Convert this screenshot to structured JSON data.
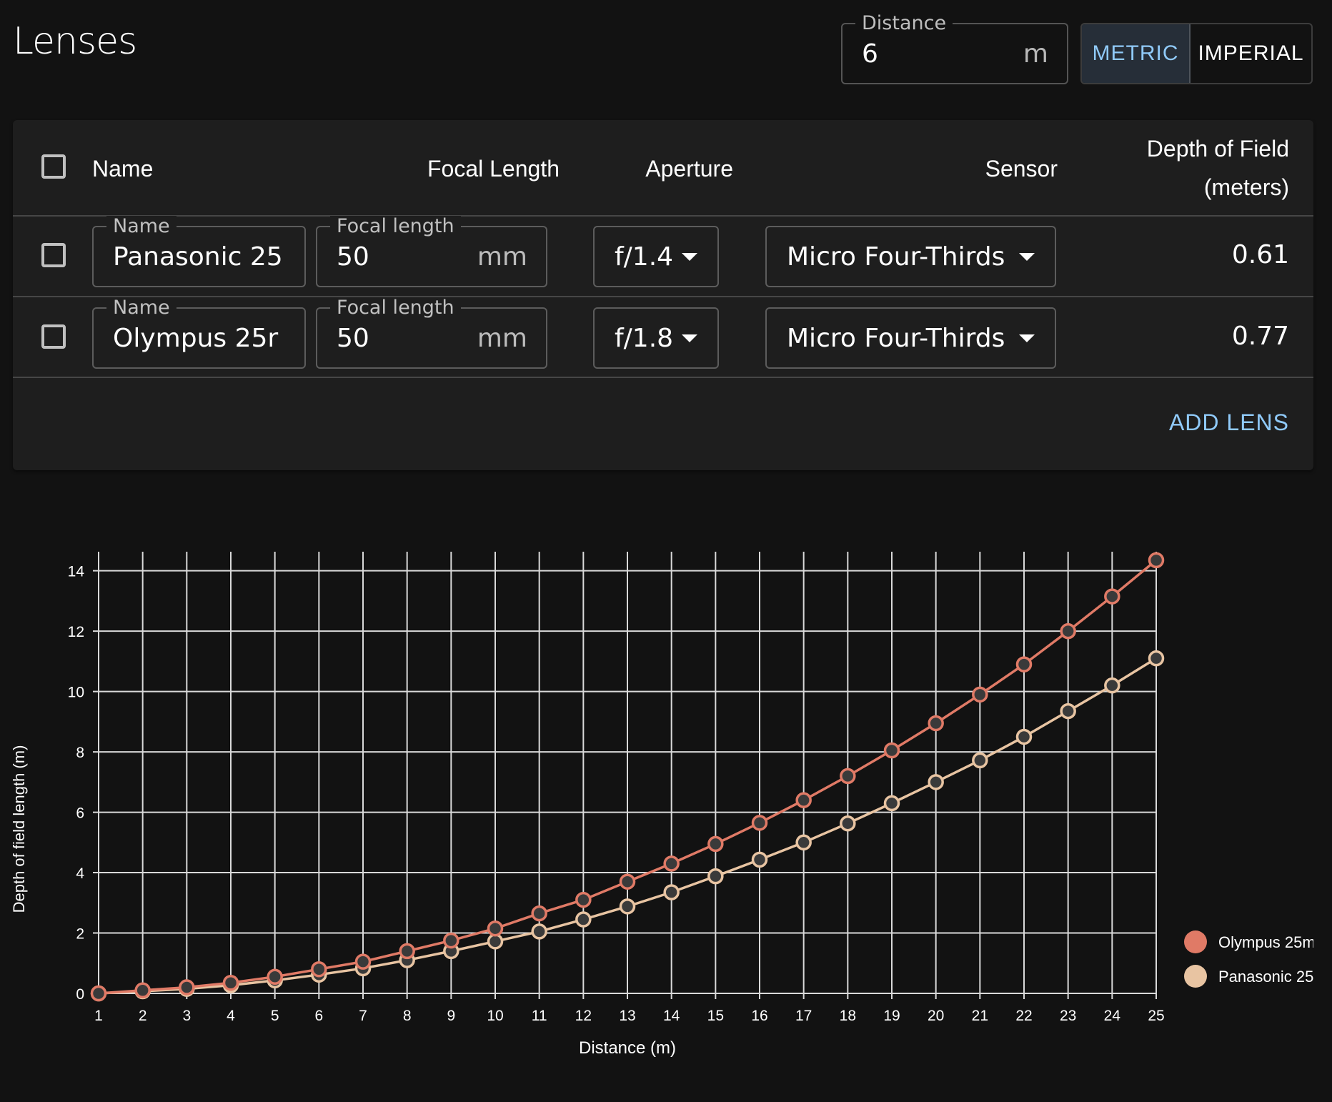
{
  "page": {
    "title": "Lenses"
  },
  "distance": {
    "label": "Distance",
    "value": "6",
    "unit": "m"
  },
  "units_toggle": {
    "metric_label": "METRIC",
    "imperial_label": "IMPERIAL",
    "selected": "METRIC"
  },
  "table": {
    "headers": {
      "name": "Name",
      "focal_length": "Focal Length",
      "aperture": "Aperture",
      "sensor": "Sensor",
      "dof_line1": "Depth of Field",
      "dof_line2": "(meters)"
    },
    "rows": [
      {
        "name_label": "Name",
        "name_value": "Panasonic 25",
        "focal_label": "Focal length",
        "focal_value": "50",
        "focal_unit": "mm",
        "aperture": "f/1.4",
        "sensor": "Micro Four-Thirds",
        "dof": "0.61"
      },
      {
        "name_label": "Name",
        "name_value": "Olympus 25r",
        "focal_label": "Focal length",
        "focal_value": "50",
        "focal_unit": "mm",
        "aperture": "f/1.8",
        "sensor": "Micro Four-Thirds",
        "dof": "0.77"
      }
    ],
    "add_label": "ADD LENS"
  },
  "colors": {
    "accent": "#90caf9",
    "series_olympus": "#e07a66",
    "series_panasonic": "#e8c4a2",
    "marker_fill": "#3a3a3a"
  },
  "chart_data": {
    "type": "line",
    "x": [
      1,
      2,
      3,
      4,
      5,
      6,
      7,
      8,
      9,
      10,
      11,
      12,
      13,
      14,
      15,
      16,
      17,
      18,
      19,
      20,
      21,
      22,
      23,
      24,
      25
    ],
    "series": [
      {
        "name": "Olympus 25m",
        "values": [
          0,
          0.1,
          0.2,
          0.35,
          0.55,
          0.8,
          1.05,
          1.4,
          1.75,
          2.15,
          2.65,
          3.1,
          3.7,
          4.3,
          4.95,
          5.65,
          6.4,
          7.2,
          8.05,
          8.95,
          9.9,
          10.9,
          12.0,
          13.15,
          14.35
        ]
      },
      {
        "name": "Panasonic 25",
        "values": [
          0,
          0.07,
          0.15,
          0.27,
          0.43,
          0.62,
          0.83,
          1.1,
          1.4,
          1.72,
          2.05,
          2.45,
          2.88,
          3.35,
          3.88,
          4.43,
          5.0,
          5.63,
          6.3,
          7.0,
          7.72,
          8.5,
          9.35,
          10.2,
          11.1
        ]
      }
    ],
    "xlabel": "Distance (m)",
    "ylabel": "Depth of field length (m)",
    "xlim": [
      1,
      25
    ],
    "ylim": [
      0,
      14.3
    ],
    "yticks": [
      0,
      2,
      4,
      6,
      8,
      10,
      12,
      14
    ],
    "grid": true,
    "legend": "right"
  }
}
